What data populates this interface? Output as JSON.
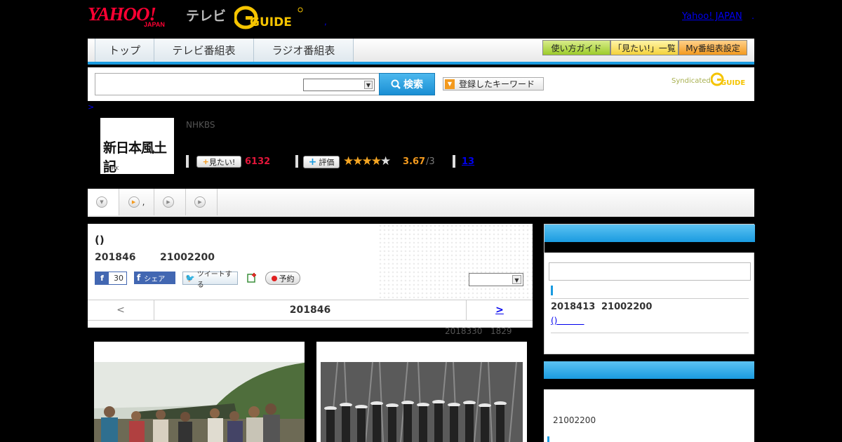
{
  "header": {
    "logo_yahoo": "YAHOO!",
    "logo_japan": "JAPAN",
    "logo_tv": "テレビ",
    "logo_gguide": "GUIDE",
    "yahoo_japan_link": "Yahoo! JAPAN",
    "link_dot": ".",
    "header_dot": ","
  },
  "nav": {
    "tabs": [
      {
        "label": "トップ"
      },
      {
        "label": "テレビ番組表"
      },
      {
        "label": "ラジオ番組表"
      }
    ],
    "buttons": [
      {
        "label": "使い方ガイド"
      },
      {
        "label": "「見たい!」一覧"
      },
      {
        "label": "My番組表設定"
      }
    ]
  },
  "search": {
    "button_label": "検索",
    "keyword_button_label": "登録したキーワード",
    "syndicated_label": "Syndicated",
    "syndicated_logo": "GUIDE"
  },
  "breadcrumb": {
    "text": ">"
  },
  "program": {
    "logo_title": "新日本風土記",
    "logo_credit": "©NHK",
    "channel": "NHKBS",
    "mitai_label": "見たい!",
    "mitai_count": "6132",
    "hyoka_label": "評価",
    "stars_on": "★★★★",
    "stars_off": "★",
    "score": "3.67",
    "score_max": "/3",
    "review_count": "13"
  },
  "subtabs": [
    {
      "label": ""
    },
    {
      "label": ","
    },
    {
      "label": ""
    },
    {
      "label": ""
    }
  ],
  "episode": {
    "title": "()",
    "date": "201846",
    "time": "21002200",
    "fb_count": "30",
    "share_label": "シェア",
    "tweet_label": "ツイートする",
    "yoyaku_label": "予約",
    "pager_prev": "<",
    "pager_current": "201846",
    "pager_next": ">",
    "updated_date": "2018330",
    "updated_time": "1829"
  },
  "sidebar": {
    "box1": {
      "date": "2018413",
      "time": "21002200",
      "link": "()"
    },
    "box2": {
      "time": "21002200"
    }
  },
  "colors": {
    "accent_blue": "#1a9be0",
    "mitai_red": "#e2163a",
    "score_orange": "#f39a1e",
    "link_blue": "#0000ee"
  }
}
